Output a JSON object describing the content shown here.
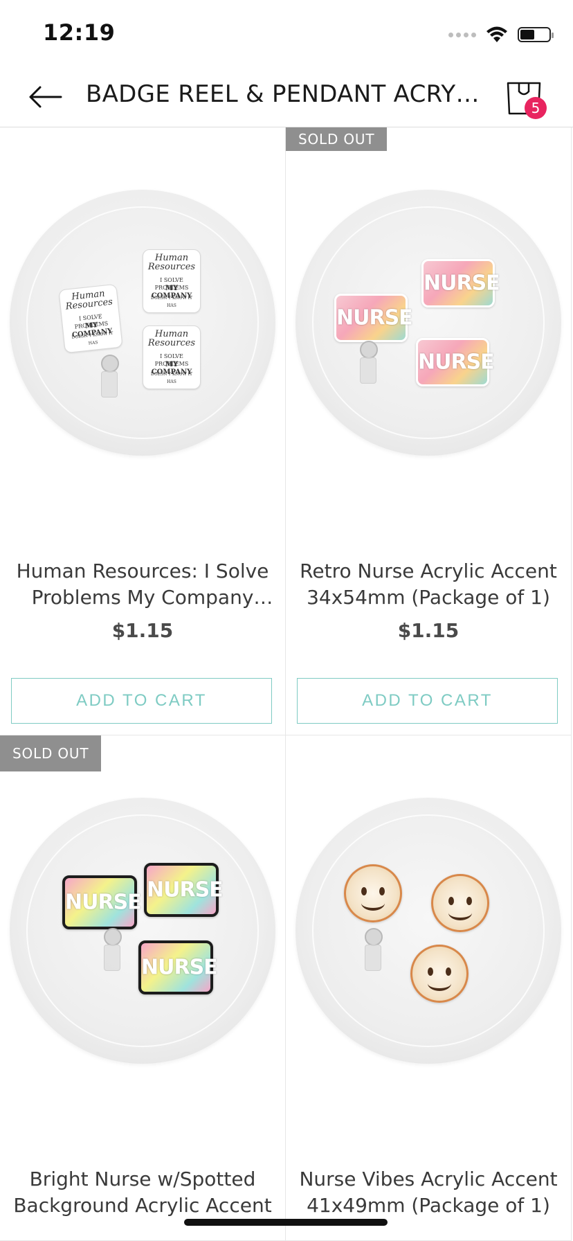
{
  "status_bar": {
    "time": "12:19"
  },
  "header": {
    "title": "BADGE REEL & PENDANT ACRYLIC A...",
    "cart_count": "5"
  },
  "products": [
    {
      "title": "Human Resources: I Solve Problems My Company Do...",
      "price": "$1.15",
      "button": "ADD TO CART",
      "sold_out": ""
    },
    {
      "title": "Retro Nurse Acrylic Accent 34x54mm (Package of 1)",
      "price": "$1.15",
      "button": "ADD TO CART",
      "sold_out": "SOLD OUT"
    },
    {
      "title": "Bright Nurse w/Spotted Background Acrylic Accent",
      "price": "",
      "button": "",
      "sold_out": "SOLD OUT"
    },
    {
      "title": "Nurse Vibes Acrylic Accent 41x49mm (Package of 1)",
      "price": "",
      "button": "",
      "sold_out": ""
    }
  ],
  "image_text": {
    "hr_line1": "Human",
    "hr_line2": "Resources",
    "hr_line3": "I SOLVE PROBLEMS",
    "hr_line4": "MY COMPANY",
    "hr_line5": "DOESN'T KNOW IT HAS",
    "nurse": "NURSE"
  },
  "colors": {
    "accent": "#7ecbc3",
    "badge": "#e8245f",
    "sold_out_bg": "#8f8f8f"
  }
}
